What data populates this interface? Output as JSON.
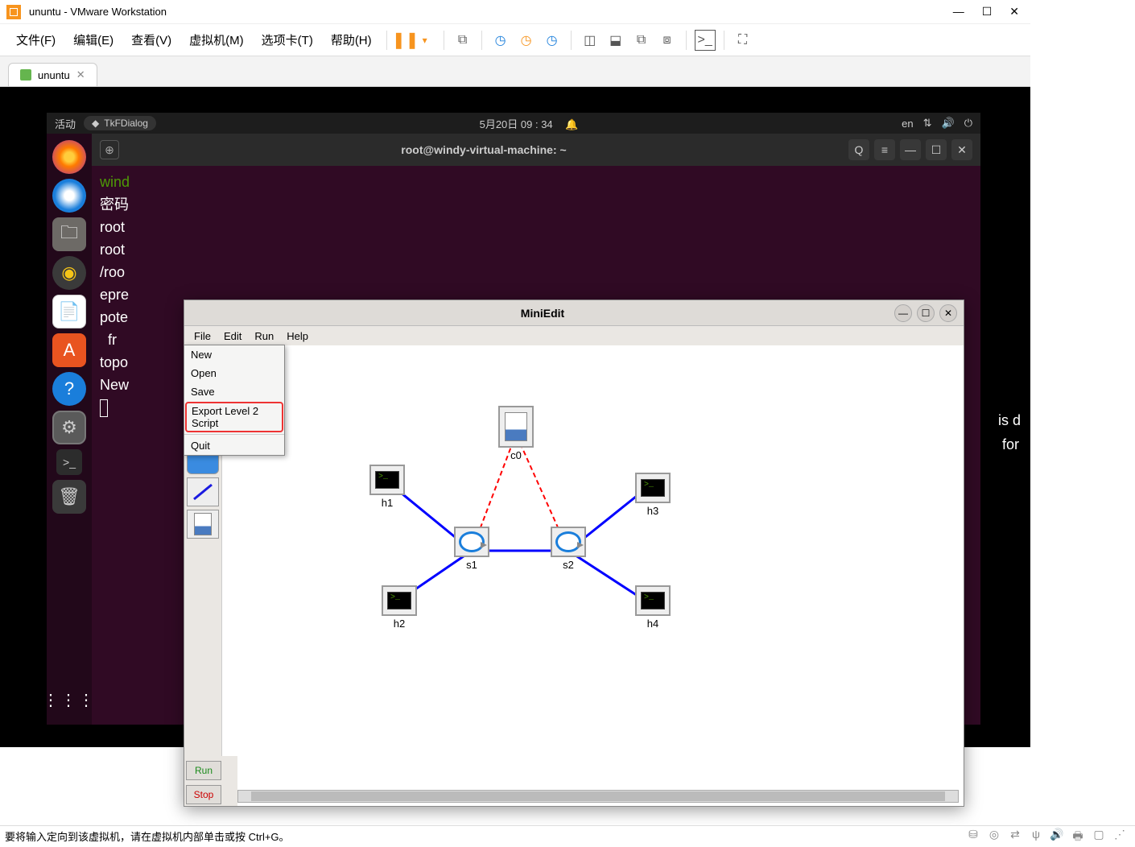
{
  "vmware": {
    "title": "ununtu - VMware Workstation",
    "menus": [
      "文件(F)",
      "编辑(E)",
      "查看(V)",
      "虚拟机(M)",
      "选项卡(T)",
      "帮助(H)"
    ],
    "tab_name": "ununtu"
  },
  "ubuntu": {
    "activities": "活动",
    "app_indicator": "TkFDialog",
    "clock": "5月20日  09 : 34",
    "lang": "en"
  },
  "terminal": {
    "title": "root@windy-virtual-machine: ~",
    "lines": {
      "l0": "wind",
      "l1": "密码",
      "l2": "root",
      "l3": "root",
      "l4": "/roo",
      "l5": "epre",
      "l6": "pote",
      "l7": "  fr",
      "l8": "topo",
      "l9": "New "
    }
  },
  "overflow": {
    "l1": "is d",
    "l2": " for"
  },
  "miniedit": {
    "title": "MiniEdit",
    "menus": [
      "File",
      "Edit",
      "Run",
      "Help"
    ],
    "file_menu": {
      "new": "New",
      "open": "Open",
      "save": "Save",
      "export": "Export Level 2 Script",
      "quit": "Quit"
    },
    "run": "Run",
    "stop": "Stop",
    "nodes": {
      "c0": "c0",
      "s1": "s1",
      "s2": "s2",
      "h1": "h1",
      "h2": "h2",
      "h3": "h3",
      "h4": "h4"
    }
  },
  "status": "要将输入定向到该虚拟机，请在虚拟机内部单击或按 Ctrl+G。"
}
